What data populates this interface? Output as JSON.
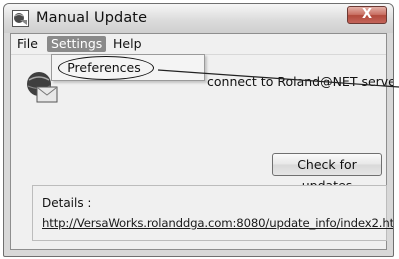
{
  "window": {
    "title": "Manual Update",
    "close_label": "X",
    "title_icon": "roland-globe-icon"
  },
  "menu": {
    "file": "File",
    "settings": "Settings",
    "help": "Help"
  },
  "settings_menu": {
    "items": [
      "Preferences"
    ],
    "highlighted_item": "Preferences"
  },
  "status": {
    "icon": "update-globe-icon",
    "text": "connect to Roland@NET server."
  },
  "actions": {
    "check_label": "Check for updates"
  },
  "details": {
    "label": "Details :",
    "link": "http://VersaWorks.rolanddga.com:8080/update_info/index2.html"
  },
  "colors": {
    "menu_active": "#8a8a8a",
    "close_button": "#c96f62",
    "window_chrome": "#d8d8d8"
  }
}
